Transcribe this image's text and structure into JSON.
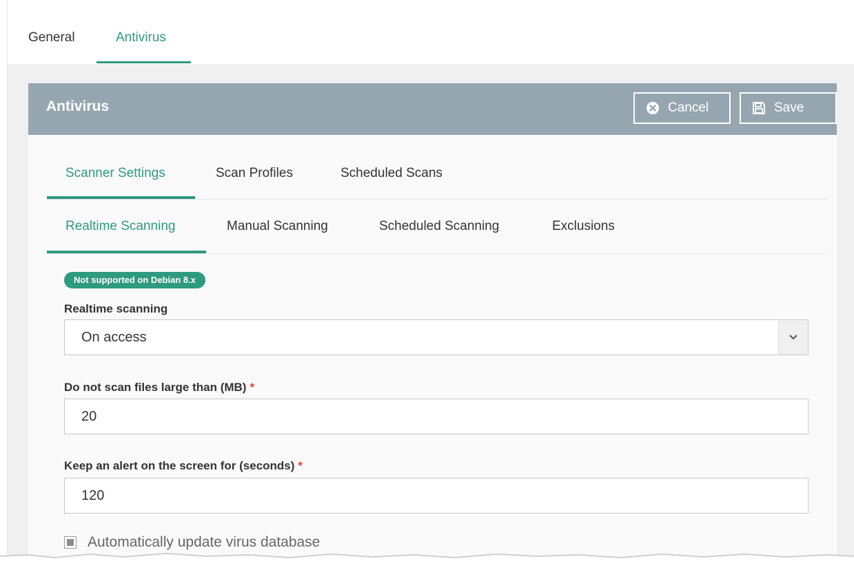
{
  "top_tabs": [
    {
      "label": "General"
    },
    {
      "label": "Antivirus"
    }
  ],
  "panel": {
    "title": "Antivirus",
    "cancel_label": "Cancel",
    "save_label": "Save"
  },
  "sub_tabs": [
    {
      "label": "Scanner Settings"
    },
    {
      "label": "Scan Profiles"
    },
    {
      "label": "Scheduled Scans"
    }
  ],
  "scanning_tabs": [
    {
      "label": "Realtime Scanning"
    },
    {
      "label": "Manual Scanning"
    },
    {
      "label": "Scheduled Scanning"
    },
    {
      "label": "Exclusions"
    }
  ],
  "form": {
    "badge": "Not supported on Debian 8.x",
    "realtime_label": "Realtime scanning",
    "realtime_value": "On access",
    "max_size_label": "Do not scan files large than (MB)",
    "max_size_value": "20",
    "alert_label": "Keep an alert on the screen for (seconds)",
    "alert_value": "120",
    "required_mark": "*",
    "auto_update_label": "Automatically update virus database"
  },
  "colors": {
    "accent": "#2e9a7e",
    "header": "#96a6b0",
    "required": "#e0413a"
  },
  "icons": {
    "cancel": "close-circle-icon",
    "save": "floppy-disk-icon",
    "dropdown": "chevron-down-icon"
  }
}
